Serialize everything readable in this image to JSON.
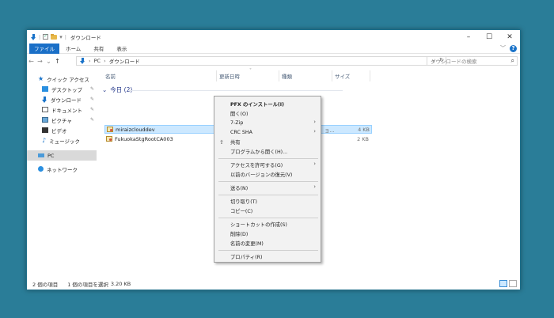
{
  "window": {
    "title": "ダウンロード",
    "controls": [
      "minimize",
      "maximize",
      "close"
    ]
  },
  "ribbon": {
    "tabs": [
      {
        "label": "ファイル",
        "active": true
      },
      {
        "label": "ホーム"
      },
      {
        "label": "共有"
      },
      {
        "label": "表示"
      }
    ]
  },
  "address": {
    "crumbs": [
      "PC",
      "ダウンロード"
    ],
    "search_placeholder": "ダウンロードの検索"
  },
  "nav": {
    "quick_access": "クイック アクセス",
    "items": [
      {
        "label": "デスクトップ",
        "icon": "desktop-icon",
        "pinned": true
      },
      {
        "label": "ダウンロード",
        "icon": "download-icon",
        "pinned": true
      },
      {
        "label": "ドキュメント",
        "icon": "documents-icon",
        "pinned": true
      },
      {
        "label": "ピクチャ",
        "icon": "pictures-icon",
        "pinned": true
      },
      {
        "label": "ビデオ",
        "icon": "videos-icon"
      },
      {
        "label": "ミュージック",
        "icon": "music-icon"
      }
    ],
    "pc": "PC",
    "network": "ネットワーク"
  },
  "columns": {
    "name": "名前",
    "modified": "更新日時",
    "type": "種類",
    "size": "サイズ"
  },
  "group": {
    "label": "今日 (2)"
  },
  "files": [
    {
      "name": "miraizclouddev",
      "type_partial": "ョ...",
      "size": "4 KB",
      "selected": true
    },
    {
      "name": "FukuokaStgRootCA003",
      "type_partial": "",
      "size": "2 KB",
      "selected": false
    }
  ],
  "status": {
    "count": "2 個の項目",
    "selection": "1 個の項目を選択",
    "size": "3.20 KB"
  },
  "context_menu": {
    "items": [
      {
        "label": "PFX のインストール(I)",
        "bold": true
      },
      {
        "label": "開く(O)"
      },
      {
        "label": "7-Zip",
        "submenu": true
      },
      {
        "label": "CRC SHA",
        "submenu": true
      },
      {
        "label": "共有",
        "icon": "share-icon"
      },
      {
        "label": "プログラムから開く(H)..."
      },
      {
        "label": "アクセスを許可する(G)",
        "submenu": true
      },
      {
        "label": "以前のバージョンの復元(V)"
      },
      {
        "label": "送る(N)",
        "submenu": true
      },
      {
        "label": "切り取り(T)"
      },
      {
        "label": "コピー(C)"
      },
      {
        "label": "ショートカットの作成(S)"
      },
      {
        "label": "削除(D)"
      },
      {
        "label": "名前の変更(M)"
      },
      {
        "label": "プロパティ(R)"
      }
    ]
  }
}
